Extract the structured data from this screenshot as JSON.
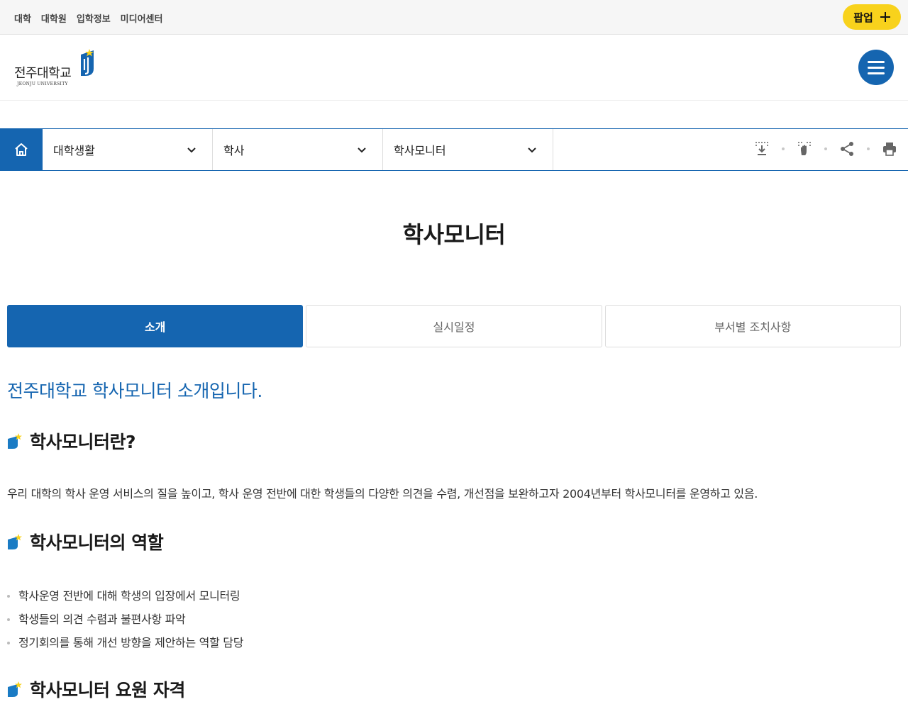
{
  "topbar": {
    "links": [
      "대학",
      "대학원",
      "입학정보",
      "미디어센터"
    ],
    "popup_label": "팝업"
  },
  "header": {
    "logo_text": "전주대학교",
    "logo_sub": "JEONJU UNIVERSITY"
  },
  "locnav": {
    "crumbs": [
      "대학생활",
      "학사",
      "학사모니터"
    ],
    "tools": [
      "download-icon",
      "braille-hand-icon",
      "share-icon",
      "print-icon"
    ]
  },
  "page": {
    "title": "학사모니터",
    "tabs": [
      {
        "label": "소개",
        "active": true
      },
      {
        "label": "실시일정",
        "active": false
      },
      {
        "label": "부서별 조치사항",
        "active": false
      }
    ],
    "intro": "전주대학교 학사모니터 소개입니다.",
    "sections": [
      {
        "heading": "학사모니터란?"
      },
      {
        "heading": "학사모니터의 역할"
      },
      {
        "heading": "학사모니터 요원 자격"
      }
    ],
    "about_text": "우리 대학의 학사 운영 서비스의 질을 높이고, 학사 운영 전반에 대한 학생들의 다양한 의견을 수렴, 개선점을 보완하고자 2004년부터 학사모니터를 운영하고 있음.",
    "roles": [
      "학사운영 전반에 대해 학생의 입장에서 모니터링",
      "학생들의 의견 수렴과 불편사항 파악",
      "정기회의를 통해 개선 방향을 제안하는 역할 담당"
    ]
  },
  "colors": {
    "primary": "#1565b0",
    "accent_yellow": "#f8d21c",
    "topbar_bg": "#f6f6f6"
  }
}
